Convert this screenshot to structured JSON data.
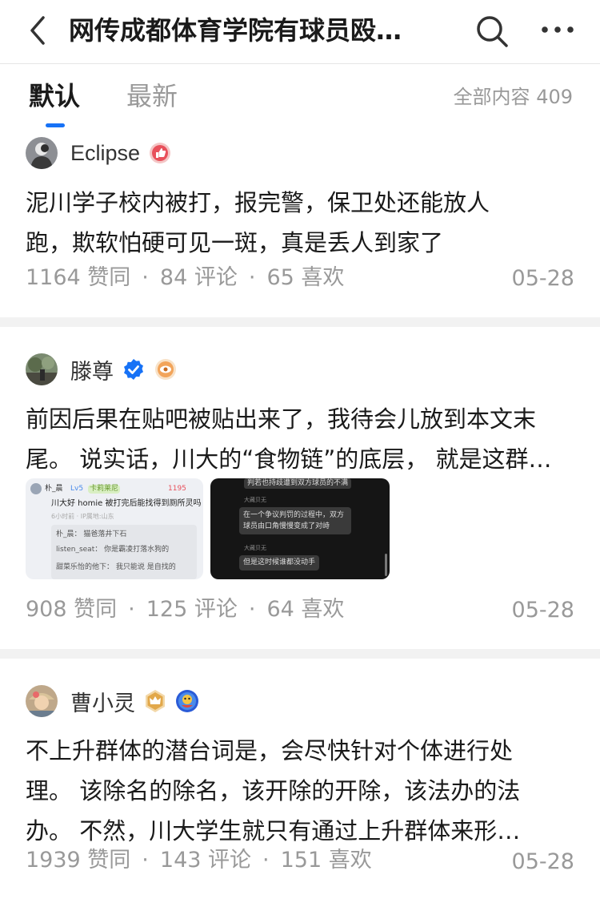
{
  "header": {
    "title": "网传成都体育学院有球员殴…",
    "back_icon": "chevron-left-icon",
    "search_icon": "search-icon",
    "more_icon": "more-horizontal-icon"
  },
  "tabs": {
    "items": [
      {
        "label": "默认",
        "active": true
      },
      {
        "label": "最新",
        "active": false
      }
    ],
    "total_label": "全部内容 409",
    "accent_color": "#1772f6"
  },
  "answers": [
    {
      "author": "Eclipse",
      "content_lines": [
        "泥川学子校内被打，报完警，保卫处还能放人",
        "跑，欺软怕硬可见一斑，真是丢人到家了"
      ],
      "stats": {
        "likes": "1164 赞同",
        "comments": "84 评论",
        "favorites": "65 喜欢"
      },
      "date": "05-28"
    },
    {
      "author": "滕尊",
      "content_lines": [
        "前因后果在贴吧被贴出来了，我待会儿放到本文末",
        "尾。 说实话，川大的“食物链”的底层， 就是这群…"
      ],
      "images": [
        {
          "kind": "comment-screenshot",
          "user": "朴_晨",
          "level": "Lv5",
          "tag": "卡莉莱尼",
          "likes": "1195",
          "text": "川大好 homie 被打完后能找得到厕所灵吗",
          "meta": "6小时前 · IP属地:山东",
          "replies": [
            "朴_晨： 猫爸落井下石",
            "listen_seat： 你是霸凌打落水狗的",
            "甜菜乐怡的他下： 我只能说 是自找的"
          ]
        },
        {
          "kind": "chat-screenshot",
          "lines": [
            "判若也持歧遭到双方球员的不满",
            "大藏贝无",
            "在一个争议判罚的过程中，双方",
            "球员由口角慢慢变成了对峙",
            "大藏贝无",
            "但是这时候谁都没动手"
          ]
        }
      ],
      "stats": {
        "likes": "908 赞同",
        "comments": "125 评论",
        "favorites": "64 喜欢"
      },
      "date": "05-28"
    },
    {
      "author": "曹小灵",
      "content_lines": [
        "不上升群体的潜台词是，会尽快针对个体进行处",
        "理。 该除名的除名，该开除的开除，该法办的法",
        "办。 不然，川大学生就只有通过上升群体来形…"
      ],
      "stats": {
        "likes": "1939 赞同",
        "comments": "143 评论",
        "favorites": "151 喜欢"
      },
      "date": "05-28"
    }
  ]
}
